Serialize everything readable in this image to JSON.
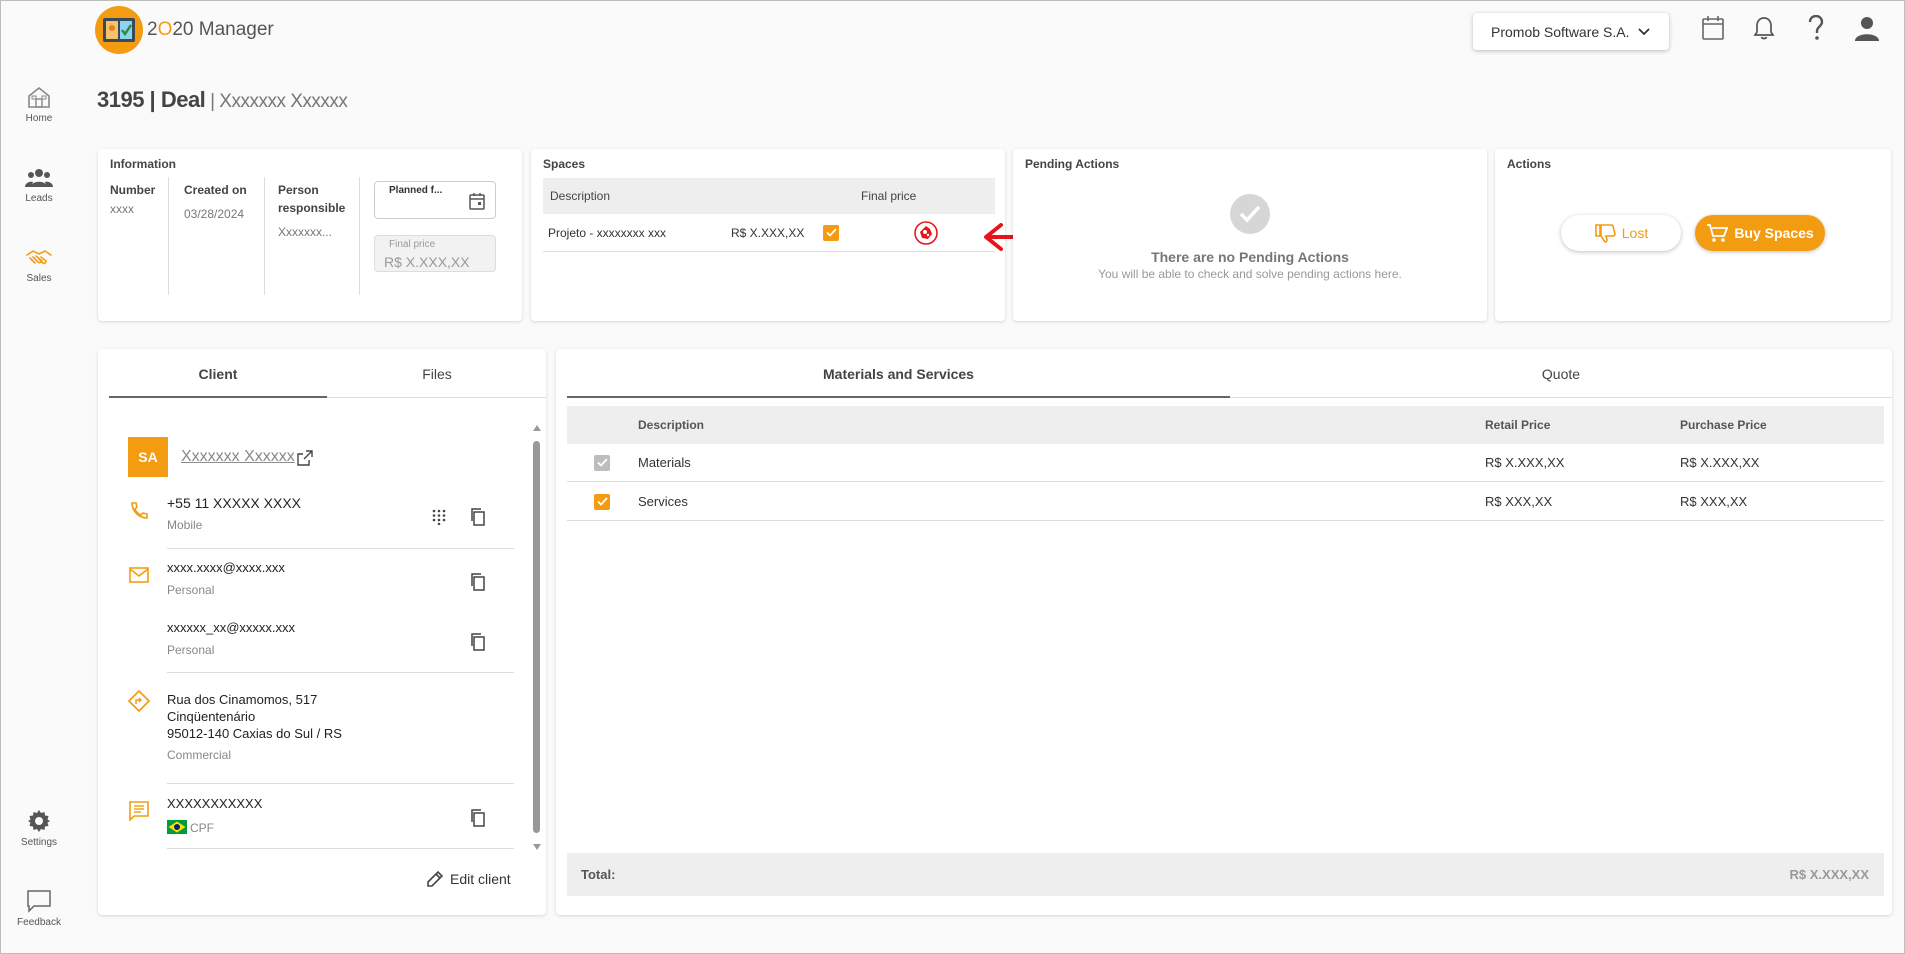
{
  "app": {
    "logo_prefix": "2",
    "logo_o": "O",
    "logo_suffix": "20 Manager"
  },
  "header": {
    "company": "Promob Software S.A."
  },
  "sidebar": {
    "items": [
      {
        "label": "Home"
      },
      {
        "label": "Leads"
      },
      {
        "label": "Sales"
      },
      {
        "label": "Settings"
      },
      {
        "label": "Feedback"
      }
    ]
  },
  "page": {
    "title_num": "3195 | Deal",
    "title_sep": " | ",
    "title_name": "Xxxxxxx Xxxxxx"
  },
  "info": {
    "title": "Information",
    "number_label": "Number",
    "number_value": "xxxx",
    "created_label": "Created on",
    "created_value": "03/28/2024",
    "person_label": "Person responsible",
    "person_value": "Xxxxxxx...",
    "planned_label": "Planned f...",
    "final_price_label": "Final price",
    "final_price_value": "R$ X.XXX,XX"
  },
  "spaces": {
    "title": "Spaces",
    "col_description": "Description",
    "col_final_price": "Final price",
    "row_description": "Projeto - xxxxxxxx xxx",
    "row_price": "R$ X.XXX,XX"
  },
  "pending": {
    "title": "Pending Actions",
    "empty_title": "There are no Pending Actions",
    "empty_sub": "You will be able to check and solve pending actions here."
  },
  "actions": {
    "title": "Actions",
    "lost_label": "Lost",
    "buy_label": "Buy Spaces"
  },
  "client_tabs": {
    "client": "Client",
    "files": "Files"
  },
  "client": {
    "initials": "SA",
    "name": "Xxxxxxx Xxxxxx",
    "phone": "+55 11 XXXXX XXXX",
    "phone_type": "Mobile",
    "email1": "xxxx.xxxx@xxxx.xxx",
    "email1_type": "Personal",
    "email2": "xxxxxx_xx@xxxxx.xxx",
    "email2_type": "Personal",
    "address1": "Rua dos Cinamomos, 517",
    "address2": "Cinqüentenário",
    "address3": "95012-140 Caxias do Sul / RS",
    "address_type": "Commercial",
    "doc": "XXXXXXXXXXX",
    "doc_type": "CPF",
    "edit_label": "Edit client"
  },
  "right_tabs": {
    "materials": "Materials and Services",
    "quote": "Quote"
  },
  "materials_table": {
    "col_description": "Description",
    "col_retail": "Retail Price",
    "col_purchase": "Purchase Price",
    "rows": [
      {
        "description": "Materials",
        "retail": "R$ X.XXX,XX",
        "purchase": "R$ X.XXX,XX"
      },
      {
        "description": "Services",
        "retail": "R$ XXX,XX",
        "purchase": "R$ XXX,XX"
      }
    ],
    "total_label": "Total:",
    "total_value": "R$ X.XXX,XX"
  },
  "colors": {
    "accent": "#f39c12",
    "annotation": "#e8141c"
  }
}
